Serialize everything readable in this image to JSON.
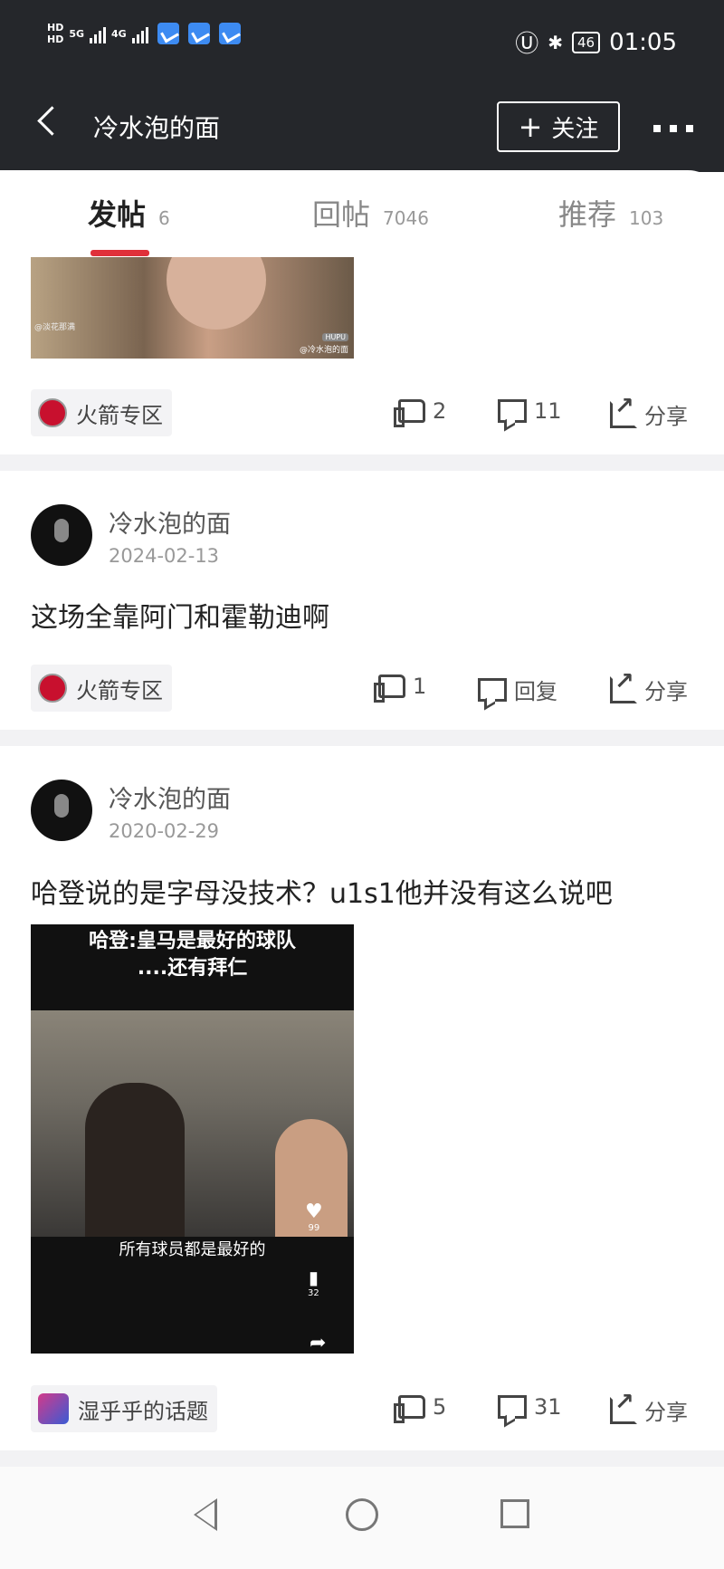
{
  "status_bar": {
    "hd1": "HD",
    "hd2": "HD",
    "net1": "5G",
    "net2": "4G",
    "battery": "46",
    "time": "01:05",
    "icons": [
      "hd-icon",
      "signal-icon",
      "app-bird-icon",
      "nfc-icon",
      "bluetooth-icon",
      "battery-icon"
    ]
  },
  "nav": {
    "title": "冷水泡的面",
    "follow_label": "关注"
  },
  "tabs": [
    {
      "label": "发帖",
      "count": "6",
      "active": true
    },
    {
      "label": "回帖",
      "count": "7046",
      "active": false
    },
    {
      "label": "推荐",
      "count": "103",
      "active": false
    }
  ],
  "posts": [
    {
      "image": {
        "watermark1": "@淡花那满",
        "watermark2": "@冷水泡的面",
        "badge": "HUPU"
      },
      "tag": "火箭专区",
      "likes": "2",
      "comments": "11",
      "share_label": "分享"
    },
    {
      "author": "冷水泡的面",
      "date": "2024-02-13",
      "text": "这场全靠阿门和霍勒迪啊",
      "tag": "火箭专区",
      "likes": "1",
      "reply_label": "回复",
      "share_label": "分享"
    },
    {
      "author": "冷水泡的面",
      "date": "2020-02-29",
      "text": "哈登说的是字母没技术？u1s1他并没有这么说吧",
      "image": {
        "caption_top_1": "哈登:皇马是最好的球队",
        "caption_top_2": "....还有拜仁",
        "caption_bottom": "所有球员都是最好的",
        "like_count": "99",
        "comment_count": "32"
      },
      "tag": "湿乎乎的话题",
      "likes": "5",
      "comments": "31",
      "share_label": "分享"
    }
  ],
  "colors": {
    "topbar": "#25272b",
    "accent": "#e0303a"
  }
}
